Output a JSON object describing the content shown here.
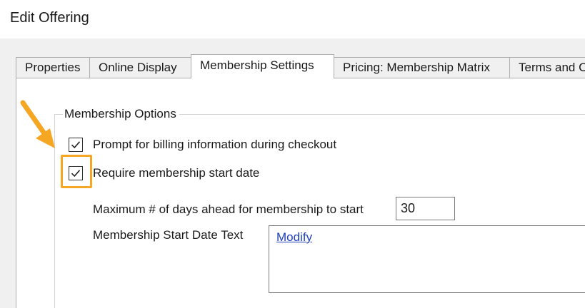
{
  "window": {
    "title": "Edit Offering"
  },
  "tabs": [
    {
      "label": "Properties",
      "active": false
    },
    {
      "label": "Online Display",
      "active": false
    },
    {
      "label": "Membership Settings",
      "active": true
    },
    {
      "label": "Pricing: Membership Matrix",
      "active": false
    },
    {
      "label": "Terms and C",
      "active": false
    }
  ],
  "membership_options": {
    "legend": "Membership Options",
    "prompt_billing": {
      "label": "Prompt for billing information during checkout",
      "checked": true
    },
    "require_start_date": {
      "label": "Require membership start date",
      "checked": true
    },
    "max_days": {
      "label": "Maximum # of days ahead for membership to start",
      "value": "30"
    },
    "start_date_text": {
      "label": "Membership Start Date Text",
      "link_label": "Modify"
    }
  },
  "annotation": {
    "color": "#f5a623"
  }
}
